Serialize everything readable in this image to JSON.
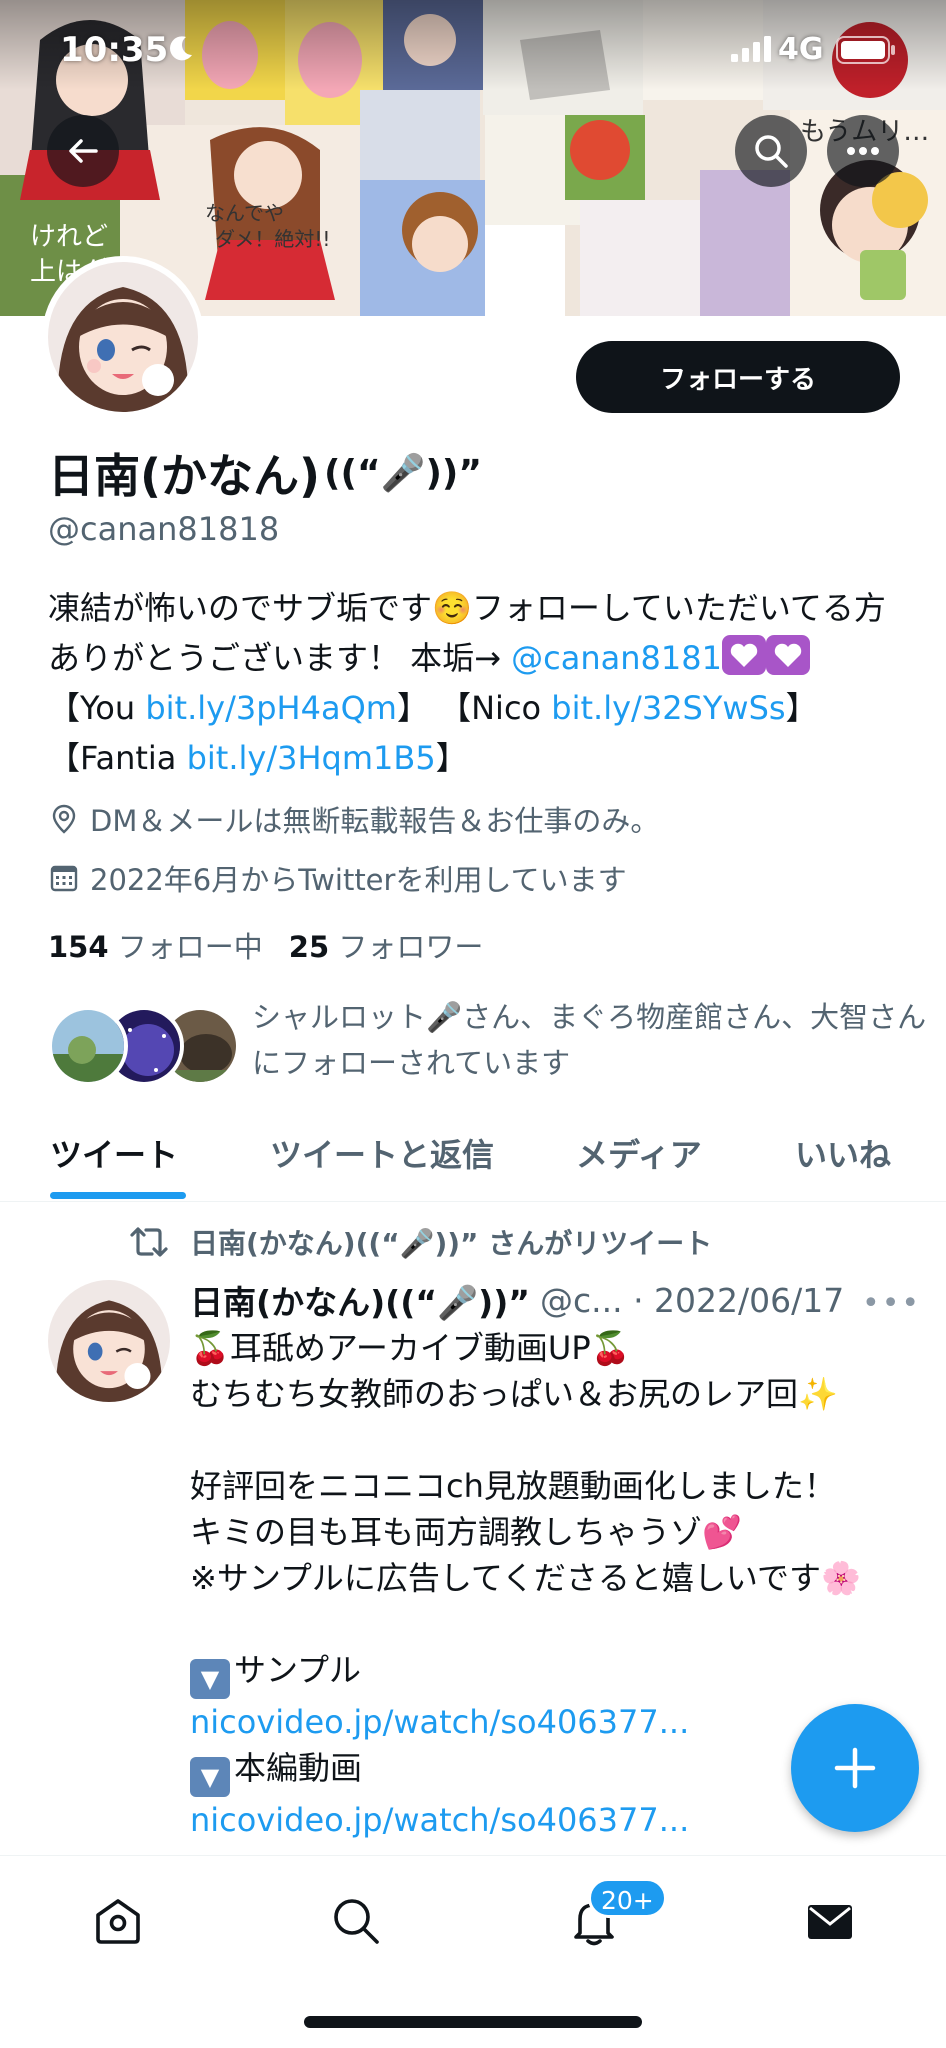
{
  "status_bar": {
    "time": "10:35",
    "network": "4G"
  },
  "banner": {
    "back_icon": "arrow-left-icon",
    "search_icon": "search-icon",
    "more_icon": "more-horizontal-icon"
  },
  "profile": {
    "follow_label": "フォローする",
    "name": "日南(かなん)",
    "name_emoji": "((“🎤))”",
    "handle": "@canan81818",
    "bio": {
      "p1": "凍結が怖いのでサブ垢です☺️フォローしていただいてる方ありがとうございます！ 本垢→ ",
      "mention": "@canan8181",
      "p2": "【You ",
      "link_you": "bit.ly/3pH4aQm",
      "p3": "】 【Nico ",
      "link_nico": "bit.ly/32SYwSs",
      "p4": "】 【Fantia ",
      "link_fantia": "bit.ly/3Hqm1B5",
      "p5": "】"
    },
    "location": "DM＆メールは無断転載報告＆お仕事のみ。",
    "joined": "2022年6月からTwitterを利用しています",
    "following_count": "154",
    "following_label": "フォロー中",
    "followers_count": "25",
    "followers_label": "フォロワー",
    "followed_by": "シャルロット🎤さん、まぐろ物産館さん、大智さんにフォローされています"
  },
  "tabs": [
    {
      "label": "ツイート"
    },
    {
      "label": "ツイートと返信"
    },
    {
      "label": "メディア"
    },
    {
      "label": "いいね"
    }
  ],
  "tweet": {
    "retweet_line": "日南(かなん)((“🎤))” さんがリツイート",
    "author_name": "日南(かなん)((“🎤))”",
    "author_handle_date": "@c... · 2022/06/17",
    "more": "•••",
    "line1": "🍒耳舐めアーカイブ動画UP🍒",
    "line2": "むちむち女教師のおっぱい＆お尻のレア回✨",
    "line3": "好評回をニコニコch見放題動画化しました！",
    "line4": "キミの目も耳も両方調教しちゃうゾ💕",
    "line5": "※サンプルに広告してくださると嬉しいです🌸",
    "sample_label": "サンプル",
    "sample_link": "nicovideo.jp/watch/so406377...",
    "main_label": "本編動画",
    "main_link": "nicovideo.jp/watch/so406377..."
  },
  "fab": {
    "icon": "plus-icon"
  },
  "bottom_nav": {
    "items": [
      "home-icon",
      "search-icon",
      "notifications-icon",
      "messages-icon"
    ],
    "badge": "20+"
  },
  "colors": {
    "accent": "#1d9bf0",
    "text": "#0f1419",
    "secondary": "#536471"
  }
}
